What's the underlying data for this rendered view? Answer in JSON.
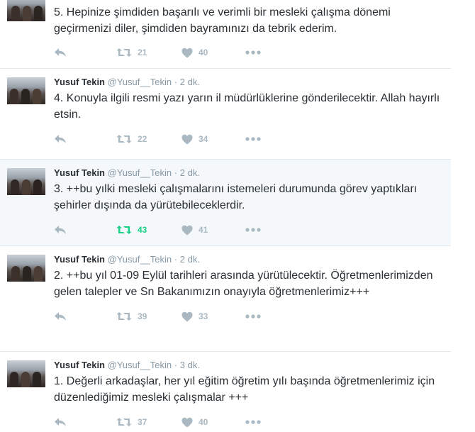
{
  "tweets": [
    {
      "fullname": "",
      "username": "",
      "time": "",
      "text": "5. Hepinize şimdiden başarılı ve verimli bir mesleki çalışma dönemi geçirmenizi diler, şimdiden bayramınızı da tebrik ederim.",
      "retweets": "21",
      "likes": "40",
      "retweeted": false
    },
    {
      "fullname": "Yusuf Tekin",
      "username": "@Yusuf__Tekin",
      "time": "2 dk.",
      "text": "4. Konuyla ilgili resmi yazı yarın il müdürlüklerine gönderilecektir. Allah hayırlı etsin.",
      "retweets": "22",
      "likes": "34",
      "retweeted": false
    },
    {
      "fullname": "Yusuf Tekin",
      "username": "@Yusuf__Tekin",
      "time": "2 dk.",
      "text": "3. ++bu yılki mesleki çalışmalarını istemeleri durumunda görev yaptıkları şehirler dışında da yürütebileceklerdir.",
      "retweets": "43",
      "likes": "41",
      "retweeted": true
    },
    {
      "fullname": "Yusuf Tekin",
      "username": "@Yusuf__Tekin",
      "time": "2 dk.",
      "text": "2. ++bu yıl 01-09 Eylül tarihleri arasında yürütülecektir. Öğretmenlerimizden gelen talepler ve Sn Bakanımızın onayıyla öğretmenlerimiz+++",
      "retweets": "39",
      "likes": "33",
      "retweeted": false
    },
    {
      "fullname": "Yusuf Tekin",
      "username": "@Yusuf__Tekin",
      "time": "3 dk.",
      "text": "1. Değerli arkadaşlar, her yıl eğitim öğretim yılı başında öğretmenlerimiz için düzenlediğimiz mesleki çalışmalar +++",
      "retweets": "37",
      "likes": "40",
      "retweeted": false
    }
  ],
  "dot": "·",
  "colors": {
    "muted": "#aab8c2",
    "retweet_active": "#19cf86",
    "divider": "#e1e8ed"
  },
  "icons": [
    "reply-icon",
    "retweet-icon",
    "heart-icon",
    "more-icon"
  ]
}
